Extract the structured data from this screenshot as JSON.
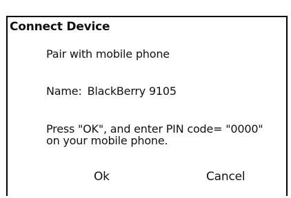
{
  "dialog": {
    "title": "Connect Device",
    "subtitle": "Pair with mobile phone",
    "name_label": "Name:",
    "name_value": "BlackBerry 9105",
    "instruction_line1": "Press \"OK\", and enter PIN code= \"0000\"",
    "instruction_line2": "on your mobile phone.",
    "ok_label": "Ok",
    "cancel_label": "Cancel"
  }
}
